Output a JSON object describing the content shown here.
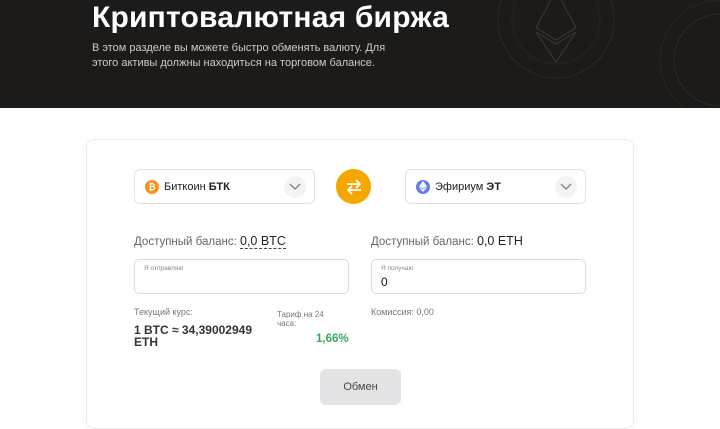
{
  "hero": {
    "title": "Криптовалютная биржа",
    "description": "В этом разделе вы можете быстро обменять валюту. Для этого активы должны находиться на торговом балансе."
  },
  "from": {
    "coin_icon": "bitcoin-icon",
    "coin_color": "#f7931a",
    "coin_glyph": "₿",
    "name": "Биткоин",
    "ticker": "БТК",
    "balance_label": "Доступный баланс:",
    "balance_value": "0,0 BTC",
    "field_label": "Я отправляю",
    "field_value": ""
  },
  "to": {
    "coin_icon": "ethereum-icon",
    "coin_color": "#627eea",
    "name": "Эфириум",
    "ticker": "ЭТ",
    "balance_label": "Доступный баланс:",
    "balance_value": "0,0 ETH",
    "field_label": "Я получаю",
    "field_value": "0"
  },
  "rate": {
    "label": "Текущий курс:",
    "value": "1 BTC ≈ 34,39002949 ETH"
  },
  "tariff": {
    "label": "Тариф на 24 часа:",
    "value": "1,66%"
  },
  "commission": "Комиссия: 0,00",
  "submit_label": "Обмен",
  "colors": {
    "accent": "#f5a700",
    "positive": "#3aa65b",
    "hero_bg": "#1d1b19"
  }
}
